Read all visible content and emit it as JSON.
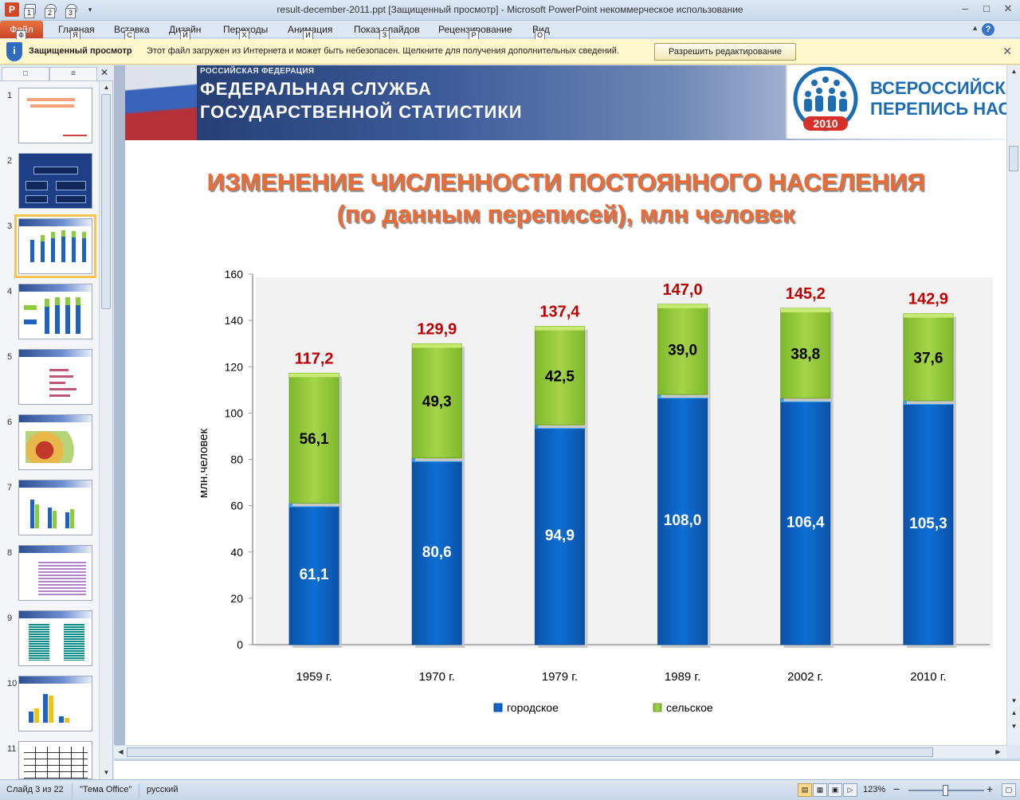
{
  "window": {
    "title": "result-december-2011.ppt [Защищенный просмотр]  -  Microsoft PowerPoint некоммерческое использование",
    "app_icon_letter": "P"
  },
  "qat": {
    "keytips": [
      "1",
      "2",
      "3"
    ],
    "customize": "▾"
  },
  "ribbon": {
    "file": {
      "label": "Файл",
      "keytip": "Ф"
    },
    "tabs": [
      {
        "label": "Главная",
        "keytip": "Я"
      },
      {
        "label": "Вставка",
        "keytip": "С"
      },
      {
        "label": "Дизайн",
        "keytip": "Й"
      },
      {
        "label": "Переходы",
        "keytip": "Х"
      },
      {
        "label": "Анимация",
        "keytip": "И"
      },
      {
        "label": "Показ слайдов",
        "keytip": "З"
      },
      {
        "label": "Рецензирование",
        "keytip": "Р"
      },
      {
        "label": "Вид",
        "keytip": "О"
      }
    ],
    "help": "?"
  },
  "message_bar": {
    "title": "Защищенный просмотр",
    "text": "Этот файл загружен из Интернета и может быть небезопасен. Щелкните для получения дополнительных сведений.",
    "button": "Разрешить редактирование",
    "icon": "i"
  },
  "thumbnails": {
    "selected": 3,
    "slides": [
      {
        "number": "1"
      },
      {
        "number": "2"
      },
      {
        "number": "3"
      },
      {
        "number": "4"
      },
      {
        "number": "5"
      },
      {
        "number": "6"
      },
      {
        "number": "7"
      },
      {
        "number": "8"
      },
      {
        "number": "9"
      },
      {
        "number": "10"
      },
      {
        "number": "11"
      }
    ]
  },
  "slide": {
    "agency_small": "РОССИЙСКАЯ ФЕДЕРАЦИЯ",
    "agency_line1": "ФЕДЕРАЛЬНАЯ СЛУЖБА",
    "agency_line2": "ГОСУДАРСТВЕННОЙ СТАТИСТИКИ",
    "census_line1": "ВСЕРОССИЙСКАЯ",
    "census_line2": "ПЕРЕПИСЬ НАСЕЛ",
    "census_year": "2010",
    "title_line1": "ИЗМЕНЕНИЕ ЧИСЛЕННОСТИ ПОСТОЯННОГО НАСЕЛЕНИЯ",
    "title_line2": "(по данным переписей), млн человек"
  },
  "chart_data": {
    "type": "bar",
    "stacked": true,
    "categories": [
      "1959 г.",
      "1970 г.",
      "1979 г.",
      "1989 г.",
      "2002 г.",
      "2010 г."
    ],
    "series": [
      {
        "name": "городское",
        "color": "#0066cc",
        "values": [
          61.1,
          80.6,
          94.9,
          108.0,
          106.4,
          105.3
        ],
        "labels": [
          "61,1",
          "80,6",
          "94,9",
          "108,0",
          "106,4",
          "105,3"
        ]
      },
      {
        "name": "сельское",
        "color": "#99cc33",
        "values": [
          56.1,
          49.3,
          42.5,
          39.0,
          38.8,
          37.6
        ],
        "labels": [
          "56,1",
          "49,3",
          "42,5",
          "39,0",
          "38,8",
          "37,6"
        ]
      }
    ],
    "totals": [
      117.2,
      129.9,
      137.4,
      147.0,
      145.2,
      142.9
    ],
    "total_labels": [
      "117,2",
      "129,9",
      "137,4",
      "147,0",
      "145,2",
      "142,9"
    ],
    "total_label_color": "#c00000",
    "ylabel": "млн.человек",
    "ylim": [
      0,
      160
    ],
    "yticks": [
      0,
      20,
      40,
      60,
      80,
      100,
      120,
      140,
      160
    ],
    "ytick_labels": [
      "0",
      "20",
      "40",
      "60",
      "80",
      "100",
      "120",
      "140",
      "160"
    ],
    "legend_position": "bottom",
    "grid": false
  },
  "status": {
    "slide_info": "Слайд 3 из 22",
    "theme": "\"Тема Office\"",
    "language": "русский",
    "zoom": "123%",
    "zoom_out": "−",
    "zoom_in": "+"
  }
}
